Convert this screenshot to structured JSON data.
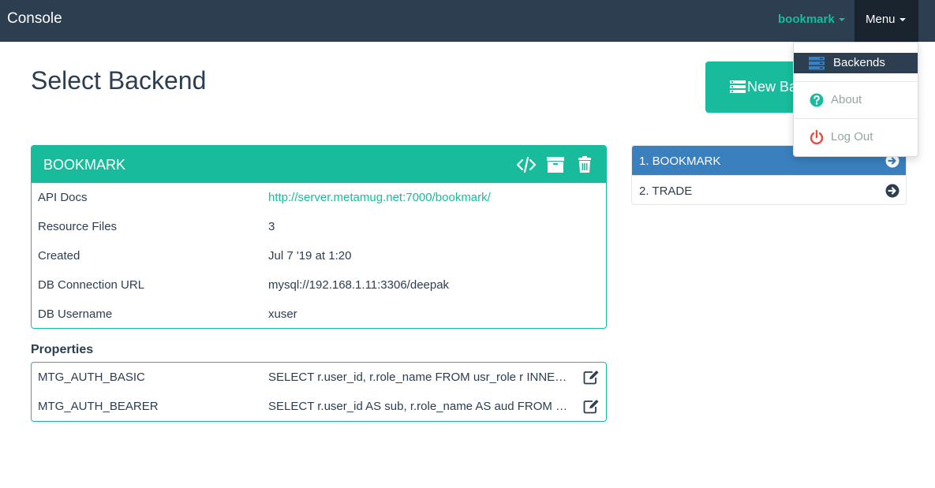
{
  "navbar": {
    "brand": "Console",
    "user_label": "bookmark",
    "menu_label": "Menu"
  },
  "page": {
    "title": "Select Backend",
    "new_button_label": "New Backend"
  },
  "backend": {
    "name": "BOOKMARK",
    "tools": [
      "code-icon",
      "archive-icon",
      "trash-icon"
    ],
    "rows": [
      {
        "key": "API Docs",
        "value": "http://server.metamug.net:7000/bookmark/"
      },
      {
        "key": "Resource Files",
        "value": "3"
      },
      {
        "key": "Created",
        "value": "Jul 7 '19 at 1:20"
      },
      {
        "key": "DB Connection URL",
        "value": "mysql://192.168.1.11:3306/deepak"
      },
      {
        "key": "DB Username",
        "value": "xuser"
      }
    ]
  },
  "properties": {
    "title": "Properties",
    "rows": [
      {
        "key": "MTG_AUTH_BASIC",
        "value": "SELECT r.user_id, r.role_name FROM usr_role r INNER JOIN usr u ON r.user_id = u.user_id"
      },
      {
        "key": "MTG_AUTH_BEARER",
        "value": "SELECT r.user_id AS sub, r.role_name AS aud FROM usr_role r INNER JOIN usr u"
      }
    ]
  },
  "backend_list": {
    "items": [
      {
        "label": "1.  BOOKMARK",
        "active": true
      },
      {
        "label": "2.  TRADE",
        "active": false
      }
    ]
  },
  "menu": {
    "items": [
      {
        "label": "Backends",
        "icon": "server-icon"
      },
      {
        "label": "About",
        "icon": "question-circle-icon"
      },
      {
        "label": "Log Out",
        "icon": "power-icon"
      }
    ]
  },
  "colors": {
    "navbar": "#2c3e50",
    "accent": "#18bc9c",
    "active_list": "#3a7fbe",
    "danger": "#e74c3c"
  }
}
